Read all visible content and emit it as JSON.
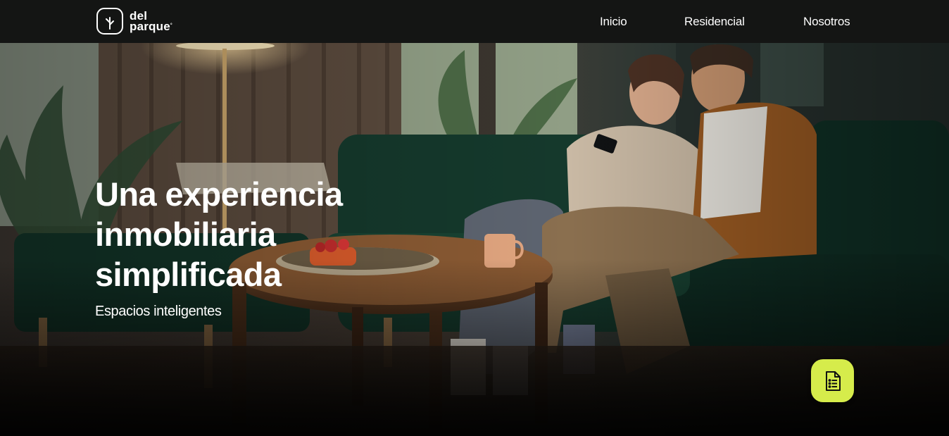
{
  "brand": {
    "logo_line1": "del",
    "logo_line2": "parque",
    "logo_mark": "°",
    "icon": "tree-icon"
  },
  "nav": {
    "items": [
      {
        "label": "Inicio"
      },
      {
        "label": "Residencial"
      },
      {
        "label": "Nosotros"
      }
    ]
  },
  "hero": {
    "title_lines": [
      "Una experiencia",
      "inmobiliaria",
      "simplificada"
    ],
    "subtitle": "Espacios inteligentes"
  },
  "fab": {
    "icon": "document-icon",
    "color": "#d6ec4b"
  },
  "colors": {
    "navbar_bg": "#141514",
    "text": "#ffffff",
    "accent": "#d6ec4b"
  }
}
